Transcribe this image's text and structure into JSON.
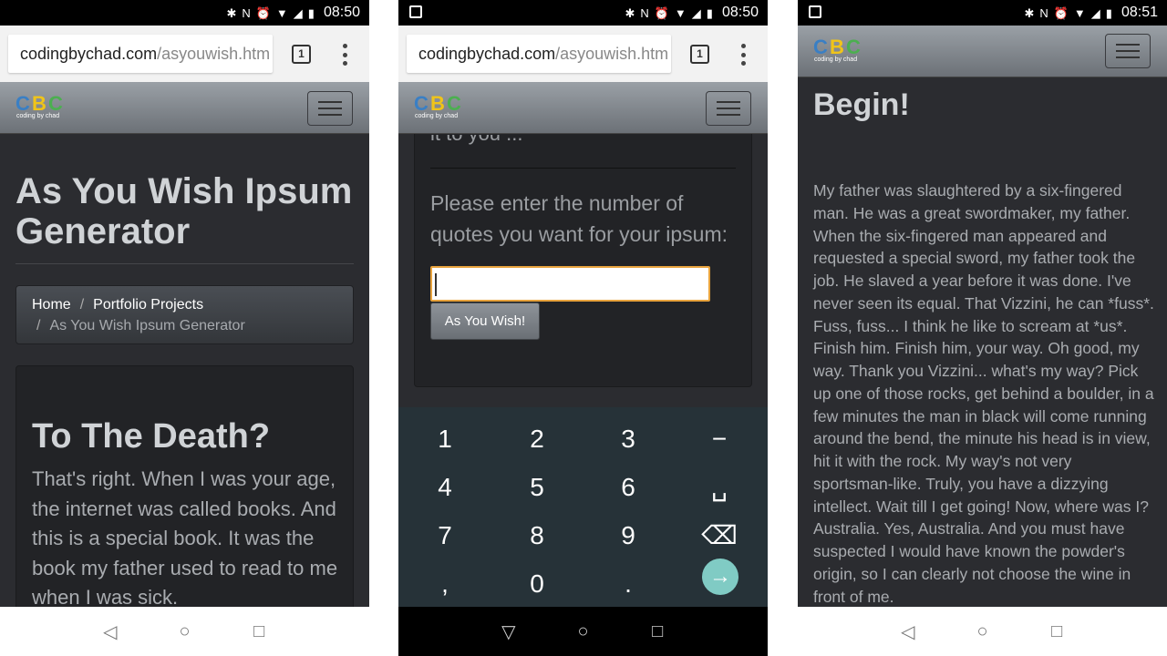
{
  "status": {
    "time_left": "08:50",
    "time_middle": "08:50",
    "time_right": "08:51"
  },
  "browser": {
    "domain": "codingbychad.com",
    "path": "/asyouwish.htm",
    "tab_count": "1"
  },
  "logo": {
    "letters": "CBC",
    "c1": "C",
    "c2": "B",
    "c3": "C",
    "tagline": "coding by chad"
  },
  "page": {
    "title": "As You Wish Ipsum Generator",
    "breadcrumb": {
      "home": "Home",
      "separator": "/",
      "portfolio": "Portfolio Projects",
      "current": "As You Wish Ipsum Generator"
    },
    "card": {
      "heading": "To The Death?",
      "lead": "That's right. When I was your age, the internet was called books. And this is a special book. It was the book my father used to read to me when I was sick.",
      "lead_tail": "it to you ...",
      "prompt": "Please enter the number of quotes you want for your ipsum:",
      "input_value": "",
      "button_label": "As You Wish!"
    }
  },
  "keyboard": {
    "keys": [
      [
        "1",
        "2",
        "3",
        "−"
      ],
      [
        "4",
        "5",
        "6",
        "␣"
      ],
      [
        "7",
        "8",
        "9",
        "⌫"
      ],
      [
        ",",
        "0",
        ".",
        "→"
      ]
    ]
  },
  "result": {
    "heading": "Begin!",
    "text": "My father was slaughtered by a six-fingered man. He was a great swordmaker, my father. When the six-fingered man appeared and requested a special sword, my father took the job. He slaved a year before it was done. I've never seen its equal.  That Vizzini, he can *fuss*. Fuss, fuss... I think he like to scream at *us*. Finish him. Finish him, your way. Oh good, my way. Thank you Vizzini... what's my way? Pick up one of those rocks, get behind a boulder, in a few minutes the man in black will come running around the bend, the minute his head is in view, hit it with the rock. My way's not very sportsman-like. Truly, you have a dizzying intellect. Wait till I get going! Now, where was I? Australia. Yes, Australia. And you must have suspected I would have known the powder's origin, so I can clearly not choose the wine in front of me."
  },
  "nav": {
    "back": "◁",
    "home": "○",
    "recents": "□",
    "back_dark": "▽"
  },
  "colors": {
    "accent_focus": "#e8a33d",
    "enter_key": "#80cbc4",
    "navbar": "#7b8086"
  }
}
